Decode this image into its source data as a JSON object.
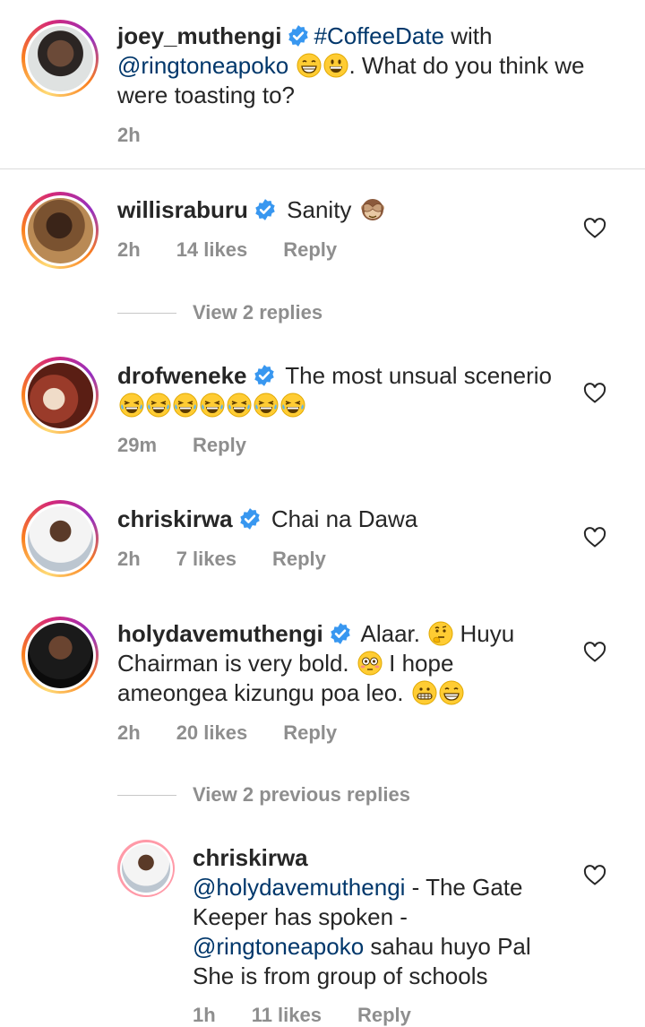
{
  "caption": {
    "username": "joey_muthengi",
    "hashtag": "#CoffeeDate",
    "text_before_mention": " with",
    "mention": "@ringtoneapoko",
    "text_after": ". What do you think we were toasting to?",
    "time": "2h"
  },
  "comments": [
    {
      "username": "willisraburu",
      "text": "Sanity",
      "time": "2h",
      "likes": "14 likes",
      "reply": "Reply"
    },
    {
      "username": "drofweneke",
      "text": "The most unsual scenerio",
      "time": "29m",
      "reply": "Reply"
    },
    {
      "username": "chriskirwa",
      "text": "Chai na Dawa",
      "time": "2h",
      "likes": "7 likes",
      "reply": "Reply"
    },
    {
      "username": "holydavemuthengi",
      "text_line1": "Alaar.",
      "text_line1b": "Huyu",
      "text_line2": "Chairman is very bold.",
      "text_line2b": "I hope",
      "text_line3": "ameongea kizungu poa leo.",
      "time": "2h",
      "likes": "20 likes",
      "reply": "Reply"
    }
  ],
  "view_replies": {
    "first": "View 2 replies",
    "second": "View 2 previous replies"
  },
  "reply": {
    "username": "chriskirwa",
    "mention1": "@holydavemuthengi",
    "text1": " - The Gate Keeper has spoken -",
    "mention2": "@ringtoneapoko",
    "text2": " sahau huyo Pal She is from group of schools",
    "time": "1h",
    "likes": "11 likes",
    "reply": "Reply"
  },
  "icons": {
    "verified": "verified-badge-icon",
    "heart": "heart-outline-icon"
  },
  "colors": {
    "verified": "#3897f0",
    "mention": "#00376b",
    "meta": "#8e8e8e"
  }
}
